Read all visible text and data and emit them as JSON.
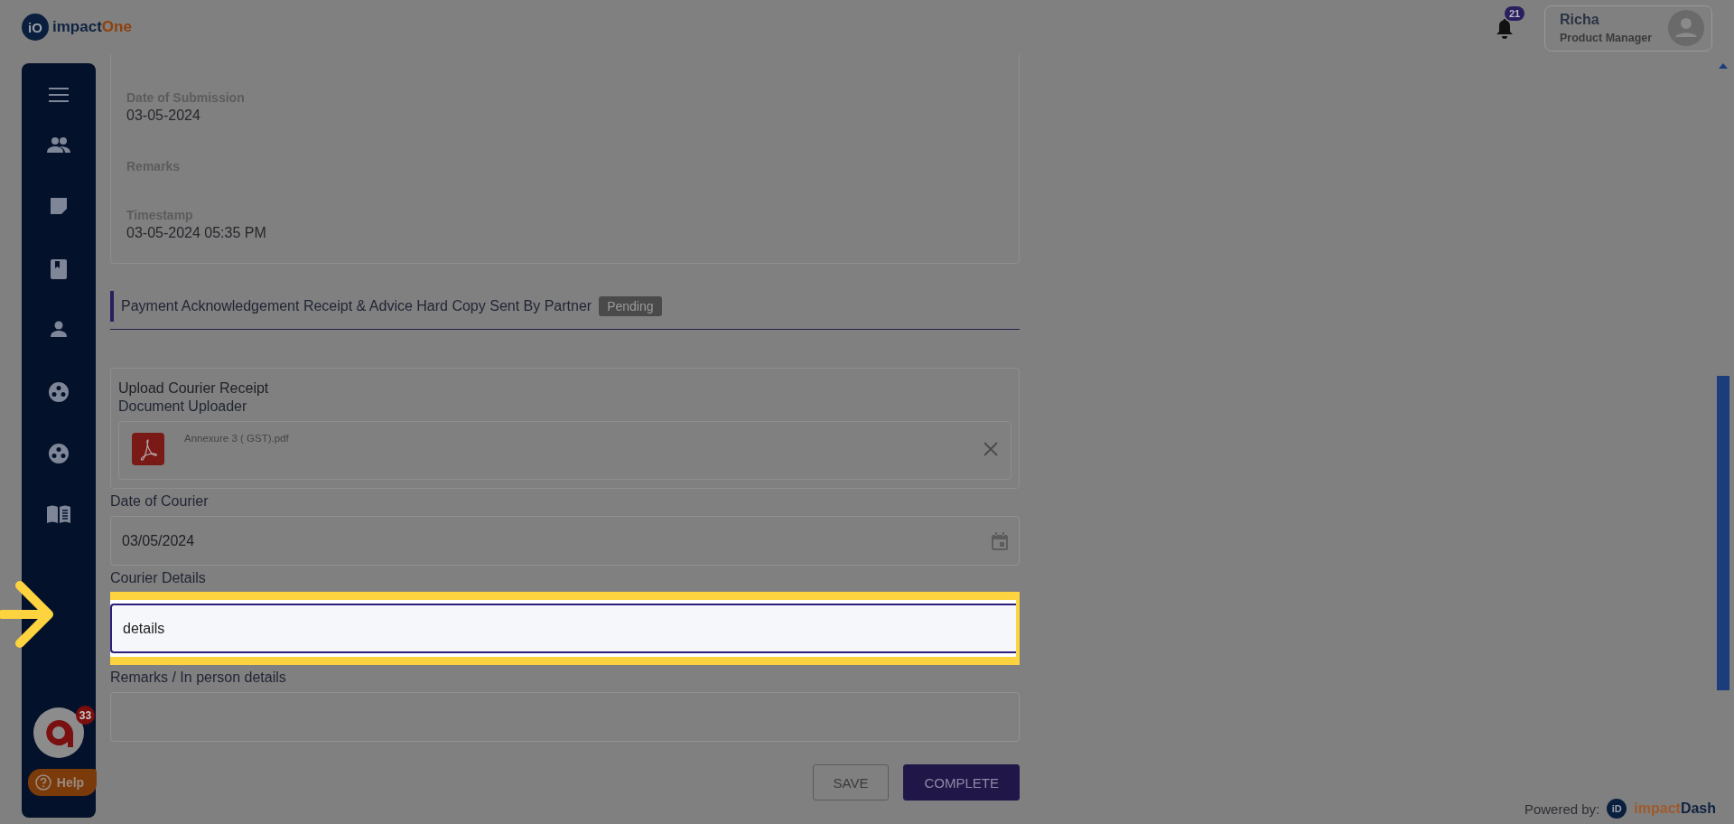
{
  "header": {
    "logo": {
      "badge": "iO",
      "text": "impact",
      "accent": "One"
    },
    "notifications": {
      "count": "21"
    },
    "user": {
      "name": "Richa",
      "role": "Product Manager"
    }
  },
  "sidebar": {
    "items": [
      {
        "kind": "menu"
      },
      {
        "kind": "group"
      },
      {
        "kind": "note"
      },
      {
        "kind": "book"
      },
      {
        "kind": "person"
      },
      {
        "kind": "reel"
      },
      {
        "kind": "reel"
      },
      {
        "kind": "reader"
      }
    ],
    "chat": {
      "count": "33"
    },
    "help": {
      "label": "Help"
    }
  },
  "submission": {
    "fields": [
      {
        "label": "Date of Submission",
        "value": "03-05-2024"
      },
      {
        "label": "Remarks"
      },
      {
        "label": "Timestamp",
        "value": "03-05-2024 05:35 PM"
      }
    ]
  },
  "section": {
    "title": "Payment Acknowledgement Receipt & Advice Hard Copy Sent By Partner",
    "status": "Pending"
  },
  "upload": {
    "title": "Upload Courier Receipt",
    "subtitle": "Document Uploader",
    "file": "Annexure 3 ( GST).pdf"
  },
  "fields": [
    {
      "kind": "date",
      "label": "Date of Courier",
      "value": "03/05/2024",
      "highlighted": false
    },
    {
      "kind": "text",
      "label": "Courier Details",
      "value": "details",
      "highlighted": true
    },
    {
      "kind": "text",
      "label": "Remarks / In person details",
      "highlighted": false
    }
  ],
  "buttons": [
    {
      "kind": "outline",
      "label": "SAVE"
    },
    {
      "kind": "primary",
      "label": "COMPLETE"
    }
  ],
  "footer": {
    "text": "Powered by:",
    "badge": "iD",
    "brand": "impact",
    "accent": "Dash"
  }
}
